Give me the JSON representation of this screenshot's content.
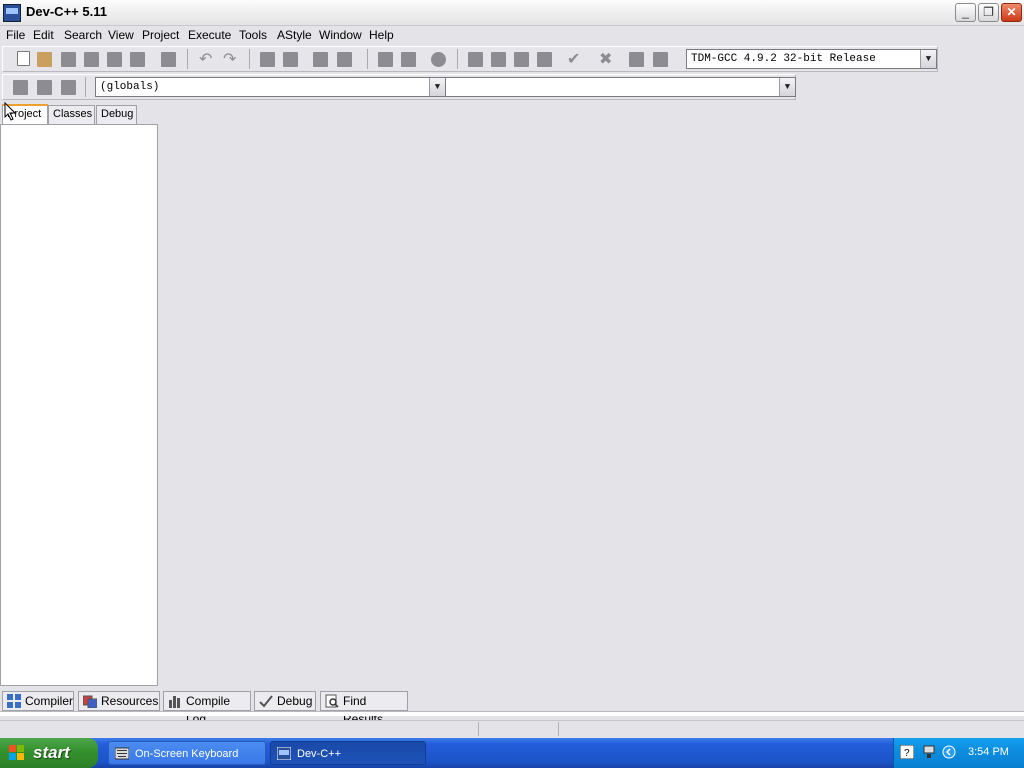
{
  "window": {
    "title": "Dev-C++ 5.11",
    "controls": [
      "minimize",
      "maximize",
      "close"
    ]
  },
  "menu": {
    "items": [
      "File",
      "Edit",
      "Search",
      "View",
      "Project",
      "Execute",
      "Tools",
      "AStyle",
      "Window",
      "Help"
    ]
  },
  "toolbar": {
    "compiler_select": "TDM-GCC 4.9.2 32-bit Release",
    "scope_select": "(globals)",
    "member_select": ""
  },
  "left_panel": {
    "tabs": [
      "Project",
      "Classes",
      "Debug"
    ],
    "active_tab": "Project"
  },
  "bottom_tabs": [
    "Compiler",
    "Resources",
    "Compile Log",
    "Debug",
    "Find Results"
  ],
  "taskbar": {
    "start_label": "start",
    "tasks": [
      "On-Screen Keyboard",
      "Dev-C++"
    ],
    "active_task": "Dev-C++",
    "clock": "3:54 PM"
  }
}
